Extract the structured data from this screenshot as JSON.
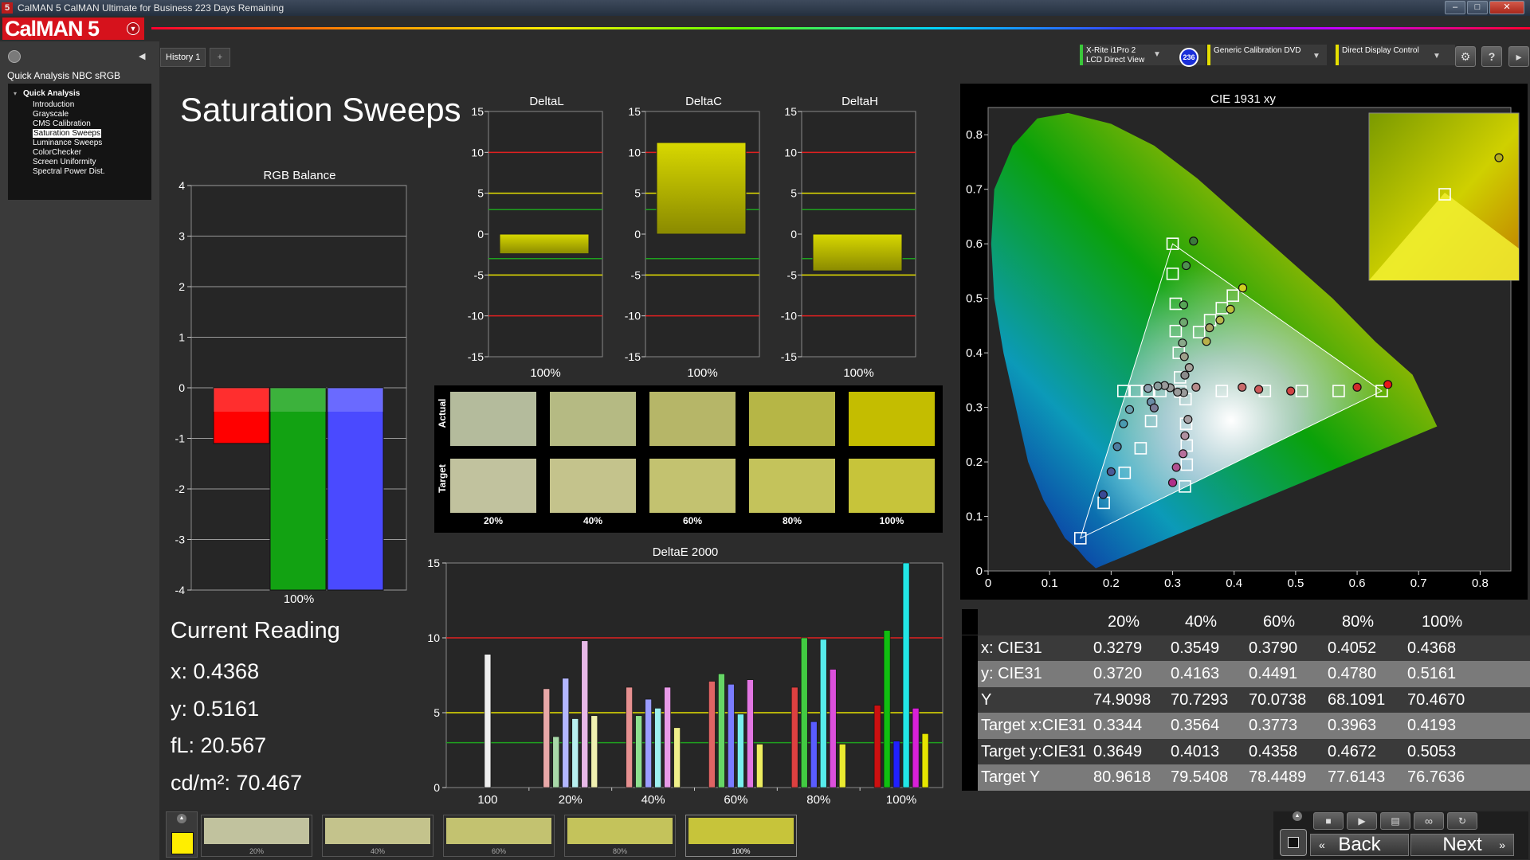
{
  "window": {
    "title": "CalMAN 5 CalMAN Ultimate for Business 223 Days Remaining",
    "app_icon": "5"
  },
  "logo": {
    "text": "CalMAN 5"
  },
  "left": {
    "workflow_title": "Quick Analysis NBC sRGB",
    "tree_root": "Quick Analysis",
    "tree_items": [
      "Introduction",
      "Grayscale",
      "CMS Calibration",
      "Saturation Sweeps",
      "Luminance Sweeps",
      "ColorChecker",
      "Screen Uniformity",
      "Spectral Power Dist."
    ],
    "selected": "Saturation Sweeps"
  },
  "tabs": {
    "history": "History 1",
    "add": "+"
  },
  "toolbar": {
    "meter": "X-Rite i1Pro 2\nLCD Direct View",
    "meter_badge": "236",
    "source": "Generic Calibration DVD",
    "display": "Direct Display Control",
    "settings_icon": "gear-icon",
    "help": "?"
  },
  "page": {
    "title": "Saturation Sweeps"
  },
  "rgb_balance": {
    "title": "RGB Balance",
    "ylim": [
      -4,
      4
    ],
    "ticks": [
      "4",
      "3",
      "2",
      "1",
      "0",
      "-1",
      "-2",
      "-3",
      "-4"
    ],
    "xlabel": "100%",
    "series": [
      {
        "name": "R",
        "value": -1.1,
        "color": "#ff0000"
      },
      {
        "name": "G",
        "value": -4.0,
        "color": "#12a212"
      },
      {
        "name": "B",
        "value": -4.0,
        "color": "#4a4aff"
      }
    ]
  },
  "delta_charts": [
    {
      "title": "DeltaL",
      "value": -2.4,
      "xlabel": "100%"
    },
    {
      "title": "DeltaC",
      "value": 11.2,
      "xlabel": "100%"
    },
    {
      "title": "DeltaH",
      "value": -4.5,
      "xlabel": "100%"
    }
  ],
  "delta_ticks": [
    "15",
    "10",
    "5",
    "0",
    "-5",
    "-10",
    "-15"
  ],
  "swatches": {
    "actual_label": "Actual",
    "target_label": "Target",
    "labels": [
      "20%",
      "40%",
      "60%",
      "80%",
      "100%"
    ],
    "actual": [
      "#b4bb9c",
      "#b5ba83",
      "#b6b668",
      "#b6b646",
      "#c4bd00"
    ],
    "target": [
      "#c1c29e",
      "#c4c38c",
      "#c3c270",
      "#c4c35b",
      "#c7c43a"
    ]
  },
  "deltae": {
    "title": "DeltaE 2000",
    "ticks": [
      "15",
      "10",
      "5",
      "0"
    ],
    "xlabels": [
      "100",
      "20%",
      "40%",
      "60%",
      "80%",
      "100%"
    ],
    "groups": [
      {
        "values": [
          8.9
        ]
      },
      {
        "values": [
          6.6,
          3.4,
          7.3,
          4.6,
          9.8,
          4.8
        ]
      },
      {
        "values": [
          6.7,
          4.8,
          5.9,
          5.3,
          6.7,
          4.0
        ]
      },
      {
        "values": [
          7.1,
          7.6,
          6.9,
          4.9,
          7.2,
          2.9
        ]
      },
      {
        "values": [
          6.7,
          10.0,
          4.4,
          9.9,
          7.9,
          2.9
        ]
      },
      {
        "values": [
          5.5,
          10.5,
          3.1,
          15.0,
          5.3,
          3.6
        ]
      }
    ],
    "group_colors": [
      [
        "#efefef"
      ],
      [
        "#e8a8a8",
        "#a8d8a8",
        "#b3b6ff",
        "#b8f0f0",
        "#e8b8e8",
        "#f0f0b0"
      ],
      [
        "#e69090",
        "#8ee08e",
        "#9a9cff",
        "#9ef0f0",
        "#e89ae8",
        "#f0f08a"
      ],
      [
        "#e06464",
        "#66d666",
        "#7a7cff",
        "#7aefef",
        "#e276e2",
        "#eded60"
      ],
      [
        "#dd4040",
        "#42cc42",
        "#5a5cff",
        "#56ecec",
        "#dc50dc",
        "#eaea30"
      ],
      [
        "#cc1010",
        "#10bf10",
        "#2020ff",
        "#22e6e6",
        "#d820d8",
        "#e6e600"
      ]
    ]
  },
  "cie": {
    "title": "CIE 1931 xy",
    "xticks": [
      "0",
      "0.1",
      "0.2",
      "0.3",
      "0.4",
      "0.5",
      "0.6",
      "0.7",
      "0.8"
    ],
    "yticks": [
      "0.8",
      "0.7",
      "0.6",
      "0.5",
      "0.4",
      "0.3",
      "0.2",
      "0.1",
      "0"
    ],
    "targets": [
      [
        0.3,
        0.6
      ],
      [
        0.3,
        0.545
      ],
      [
        0.305,
        0.49
      ],
      [
        0.305,
        0.44
      ],
      [
        0.31,
        0.4
      ],
      [
        0.312,
        0.355
      ],
      [
        0.321,
        0.315
      ],
      [
        0.322,
        0.27
      ],
      [
        0.323,
        0.23
      ],
      [
        0.323,
        0.195
      ],
      [
        0.32,
        0.155
      ],
      [
        0.343,
        0.438
      ],
      [
        0.361,
        0.46
      ],
      [
        0.38,
        0.482
      ],
      [
        0.398,
        0.505
      ],
      [
        0.3127,
        0.329
      ],
      [
        0.22,
        0.33
      ],
      [
        0.24,
        0.33
      ],
      [
        0.26,
        0.33
      ],
      [
        0.28,
        0.33
      ],
      [
        0.38,
        0.33
      ],
      [
        0.45,
        0.33
      ],
      [
        0.51,
        0.33
      ],
      [
        0.57,
        0.33
      ],
      [
        0.64,
        0.33
      ],
      [
        0.265,
        0.275
      ],
      [
        0.248,
        0.225
      ],
      [
        0.222,
        0.18
      ],
      [
        0.188,
        0.125
      ],
      [
        0.15,
        0.06
      ]
    ],
    "measured": [
      [
        0.334,
        0.605
      ],
      [
        0.322,
        0.56
      ],
      [
        0.318,
        0.488
      ],
      [
        0.318,
        0.456
      ],
      [
        0.316,
        0.418
      ],
      [
        0.319,
        0.393
      ],
      [
        0.327,
        0.373
      ],
      [
        0.355,
        0.421
      ],
      [
        0.377,
        0.46
      ],
      [
        0.394,
        0.48
      ],
      [
        0.414,
        0.519
      ],
      [
        0.36,
        0.446
      ],
      [
        0.32,
        0.359
      ],
      [
        0.318,
        0.327
      ],
      [
        0.308,
        0.328
      ],
      [
        0.296,
        0.336
      ],
      [
        0.287,
        0.34
      ],
      [
        0.276,
        0.339
      ],
      [
        0.26,
        0.335
      ],
      [
        0.23,
        0.296
      ],
      [
        0.265,
        0.31
      ],
      [
        0.27,
        0.299
      ],
      [
        0.22,
        0.27
      ],
      [
        0.21,
        0.228
      ],
      [
        0.2,
        0.182
      ],
      [
        0.187,
        0.14
      ],
      [
        0.338,
        0.337
      ],
      [
        0.413,
        0.337
      ],
      [
        0.44,
        0.333
      ],
      [
        0.492,
        0.33
      ],
      [
        0.6,
        0.337
      ],
      [
        0.65,
        0.342
      ],
      [
        0.3,
        0.162
      ],
      [
        0.306,
        0.19
      ],
      [
        0.317,
        0.215
      ],
      [
        0.32,
        0.248
      ],
      [
        0.325,
        0.278
      ]
    ],
    "measured_colors": [
      "#3c7a3c",
      "#4e8f4e",
      "#56a556",
      "#70a870",
      "#8aa88a",
      "#9ea08a",
      "#a6a09a",
      "#b9b04a",
      "#b6b64a",
      "#bdbf3a",
      "#d0d020",
      "#a7a060",
      "#8a8a8a",
      "#9b9b9b",
      "#9b9b9b",
      "#9b9b9b",
      "#9b9b9b",
      "#8a9b9b",
      "#90a0b0",
      "#6aa0b0",
      "#6a8ca6",
      "#7a7a96",
      "#4a9ab0",
      "#4e7ca0",
      "#4a5a96",
      "#3a4a96",
      "#b58a8a",
      "#c86a6a",
      "#cc5a5a",
      "#d04444",
      "#d02a2a",
      "#e81818",
      "#b0308a",
      "#b05090",
      "#b8709c",
      "#b090a0",
      "#a8a0a4"
    ]
  },
  "current": {
    "title": "Current Reading",
    "x": "x: 0.4368",
    "y": "y: 0.5161",
    "fl": "fL: 20.567",
    "cdm2": "cd/m²: 70.467"
  },
  "table": {
    "headers": [
      "20%",
      "40%",
      "60%",
      "80%",
      "100%"
    ],
    "rows": [
      {
        "label": "x: CIE31",
        "values": [
          "0.3279",
          "0.3549",
          "0.3790",
          "0.4052",
          "0.4368"
        ]
      },
      {
        "label": "y: CIE31",
        "values": [
          "0.3720",
          "0.4163",
          "0.4491",
          "0.4780",
          "0.5161"
        ]
      },
      {
        "label": "Y",
        "values": [
          "74.9098",
          "70.7293",
          "70.0738",
          "68.1091",
          "70.4670"
        ]
      },
      {
        "label": "Target x:CIE31",
        "values": [
          "0.3344",
          "0.3564",
          "0.3773",
          "0.3963",
          "0.4193"
        ]
      },
      {
        "label": "Target y:CIE31",
        "values": [
          "0.3649",
          "0.4013",
          "0.4358",
          "0.4672",
          "0.5053"
        ]
      },
      {
        "label": "Target Y",
        "values": [
          "80.9618",
          "79.5408",
          "78.4489",
          "77.6143",
          "76.7636"
        ]
      }
    ]
  },
  "bottom": {
    "current_color": "#ffee00",
    "swatches": [
      {
        "label": "20%",
        "color": "#c1c29e"
      },
      {
        "label": "40%",
        "color": "#c4c38c"
      },
      {
        "label": "60%",
        "color": "#c3c270"
      },
      {
        "label": "80%",
        "color": "#c4c35b"
      },
      {
        "label": "100%",
        "color": "#c7c43a"
      }
    ],
    "back": "Back",
    "next": "Next"
  }
}
